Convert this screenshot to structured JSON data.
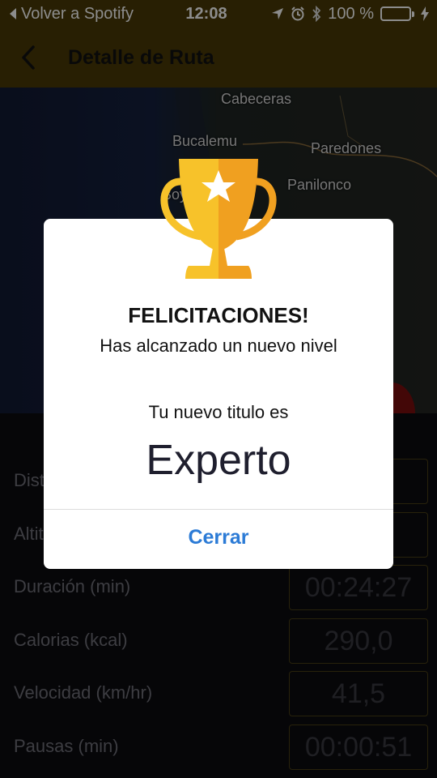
{
  "status_bar": {
    "back_app": "Volver a Spotify",
    "time": "12:08",
    "battery_percent": "100 %",
    "battery_level": 1.0,
    "icons": [
      "location-arrow-icon",
      "alarm-icon",
      "bluetooth-icon",
      "charging-bolt-icon"
    ]
  },
  "nav": {
    "title": "Detalle de Ruta",
    "back_icon": "chevron-left-icon",
    "background_color": "#4a3a06"
  },
  "map": {
    "labels": [
      "Cabeceras",
      "Bucalemu",
      "Paredones",
      "Panilonco",
      "Boy"
    ]
  },
  "stats": [
    {
      "label": "Distancia",
      "value": ""
    },
    {
      "label": "Altitud",
      "value": ""
    },
    {
      "label": "Duración (min)",
      "value": "00:24:27"
    },
    {
      "label": "Calorias (kcal)",
      "value": "290,0"
    },
    {
      "label": "Velocidad (km/hr)",
      "value": "41,5"
    },
    {
      "label": "Pausas (min)",
      "value": "00:00:51"
    }
  ],
  "dialog": {
    "title": "FELICITACIONES!",
    "subtitle": "Has alcanzado un nuevo nivel",
    "prompt": "Tu nuevo titulo es",
    "level": "Experto",
    "close_label": "Cerrar",
    "trophy_icon": "trophy-icon",
    "accent_color": "#2c7bd6"
  },
  "colors": {
    "trophy_light": "#f7c22a",
    "trophy_dark": "#f0a020",
    "record_button": "#7a0e0e"
  }
}
